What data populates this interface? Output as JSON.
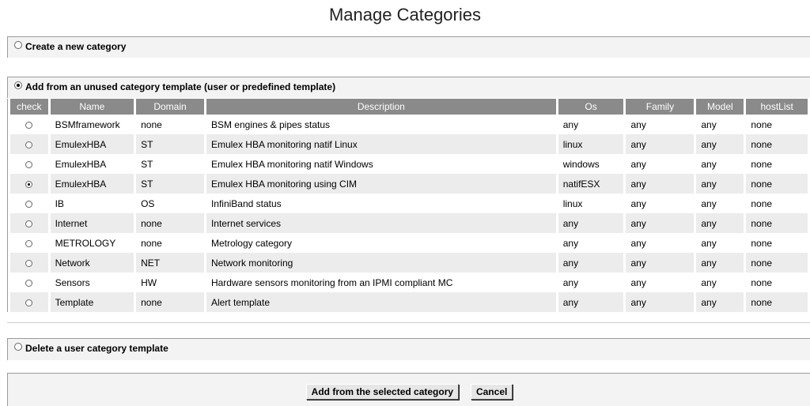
{
  "title": "Manage Categories",
  "options": {
    "create": "Create a new category",
    "add_from_template": "Add from an unused category template (user or predefined template)",
    "delete": "Delete a user category template"
  },
  "table": {
    "headers": [
      "check",
      "Name",
      "Domain",
      "Description",
      "Os",
      "Family",
      "Model",
      "hostList"
    ],
    "rows": [
      {
        "checked": false,
        "name": "BSMframework",
        "domain": "none",
        "description": "BSM engines & pipes status",
        "os": "any",
        "family": "any",
        "model": "any",
        "hostlist": "none"
      },
      {
        "checked": false,
        "name": "EmulexHBA",
        "domain": "ST",
        "description": "Emulex HBA monitoring natif Linux",
        "os": "linux",
        "family": "any",
        "model": "any",
        "hostlist": "none"
      },
      {
        "checked": false,
        "name": "EmulexHBA",
        "domain": "ST",
        "description": "Emulex HBA monitoring natif Windows",
        "os": "windows",
        "family": "any",
        "model": "any",
        "hostlist": "none"
      },
      {
        "checked": true,
        "name": "EmulexHBA",
        "domain": "ST",
        "description": "Emulex HBA monitoring using CIM",
        "os": "natifESX",
        "family": "any",
        "model": "any",
        "hostlist": "none"
      },
      {
        "checked": false,
        "name": "IB",
        "domain": "OS",
        "description": "InfiniBand status",
        "os": "linux",
        "family": "any",
        "model": "any",
        "hostlist": "none"
      },
      {
        "checked": false,
        "name": "Internet",
        "domain": "none",
        "description": "Internet services",
        "os": "any",
        "family": "any",
        "model": "any",
        "hostlist": "none"
      },
      {
        "checked": false,
        "name": "METROLOGY",
        "domain": "none",
        "description": "Metrology category",
        "os": "any",
        "family": "any",
        "model": "any",
        "hostlist": "none"
      },
      {
        "checked": false,
        "name": "Network",
        "domain": "NET",
        "description": "Network monitoring",
        "os": "any",
        "family": "any",
        "model": "any",
        "hostlist": "none"
      },
      {
        "checked": false,
        "name": "Sensors",
        "domain": "HW",
        "description": "Hardware sensors monitoring from an IPMI compliant MC",
        "os": "any",
        "family": "any",
        "model": "any",
        "hostlist": "none"
      },
      {
        "checked": false,
        "name": "Template",
        "domain": "none",
        "description": "Alert template",
        "os": "any",
        "family": "any",
        "model": "any",
        "hostlist": "none"
      }
    ]
  },
  "buttons": {
    "add": "Add from the selected category",
    "cancel": "Cancel"
  },
  "selected_option": "add_from_template"
}
